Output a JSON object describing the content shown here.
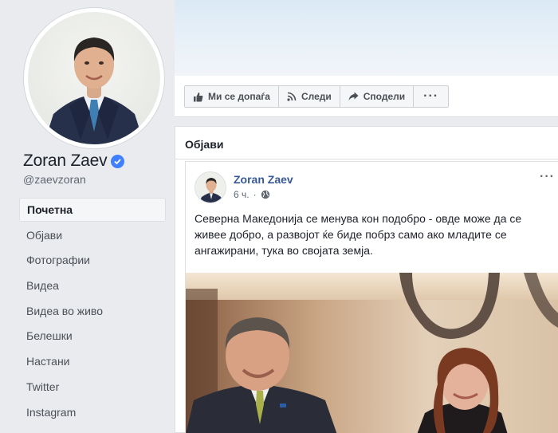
{
  "profile": {
    "name": "Zoran Zaev",
    "handle": "@zaevzoran"
  },
  "nav": {
    "items": [
      {
        "label": "Почетна",
        "active": true
      },
      {
        "label": "Објави"
      },
      {
        "label": "Фотографии"
      },
      {
        "label": "Видеа"
      },
      {
        "label": "Видеа во живо"
      },
      {
        "label": "Белешки"
      },
      {
        "label": "Настани"
      },
      {
        "label": "Twitter"
      },
      {
        "label": "Instagram"
      }
    ]
  },
  "actions": {
    "like": "Ми се допаѓа",
    "follow": "Следи",
    "share": "Сподели",
    "more": "···"
  },
  "posts_section": {
    "title": "Објави"
  },
  "post": {
    "author": "Zoran Zaev",
    "time": "6 ч.",
    "dot": "·",
    "text": "Северна Македонија се менува кон подобро - овде може да се живее добро, а развојот ќе биде побрз само ако младите се ангажирани, тука во својата земја.",
    "more": "···"
  },
  "colors": {
    "link": "#385898",
    "verified": "#4080ff",
    "background": "#e9ebee"
  },
  "icons": [
    "thumbs-up-icon",
    "rss-icon",
    "share-arrow-icon",
    "verified-icon",
    "globe-icon"
  ]
}
